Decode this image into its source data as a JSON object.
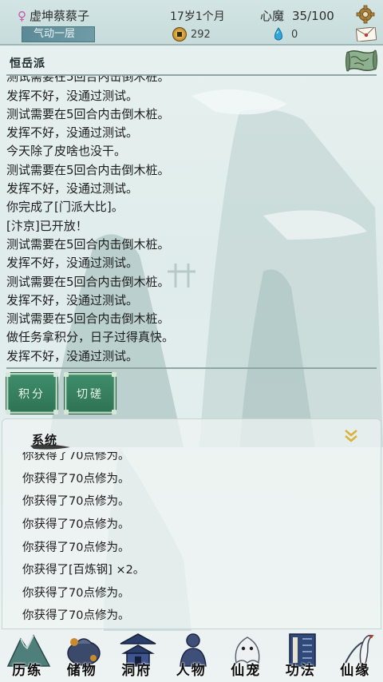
{
  "header": {
    "gender_symbol": "♀",
    "player_name": "虚坤蔡蔡子",
    "age": "17岁1个月",
    "demon_label": "心魔",
    "demon_value": "35/100",
    "realm": "气动一层",
    "coins": "292",
    "gems": "0",
    "icons": [
      "gear-icon",
      "coin-icon",
      "spirit-gem-icon",
      "mail-icon"
    ]
  },
  "sect": {
    "name": "恒岳派",
    "map_icon": "scroll-map-icon"
  },
  "log": {
    "lines": [
      "测试需要在5回合内击倒木桩。",
      "发挥不好，没通过测试。",
      "测试需要在5回合内击倒木桩。",
      "发挥不好，没通过测试。",
      "今天除了皮啥也没干。",
      "测试需要在5回合内击倒木桩。",
      "发挥不好，没通过测试。",
      "你完成了[门派大比]。",
      "[汴京]已开放！",
      "测试需要在5回合内击倒木桩。",
      "发挥不好，没通过测试。",
      "测试需要在5回合内击倒木桩。",
      "发挥不好，没通过测试。",
      "测试需要在5回合内击倒木桩。",
      "做任务拿积分，日子过得真快。",
      "发挥不好，没通过测试。"
    ]
  },
  "actions": {
    "points": "积分",
    "spar": "切磋"
  },
  "system": {
    "title": "系统",
    "lines": [
      "你获得了70点修为。",
      "你获得了70点修为。",
      "你获得了70点修为。",
      "你获得了70点修为。",
      "你获得了70点修为。",
      "你获得了[百炼钢] ×2。",
      "你获得了70点修为。",
      "你获得了70点修为。"
    ]
  },
  "nav": [
    {
      "label": "历练",
      "icon": "mountain-icon"
    },
    {
      "label": "储物",
      "icon": "pouch-icon"
    },
    {
      "label": "洞府",
      "icon": "pavilion-icon"
    },
    {
      "label": "人物",
      "icon": "person-icon"
    },
    {
      "label": "仙宠",
      "icon": "spirit-pet-icon"
    },
    {
      "label": "功法",
      "icon": "scroll-book-icon"
    },
    {
      "label": "仙缘",
      "icon": "crane-icon"
    }
  ]
}
